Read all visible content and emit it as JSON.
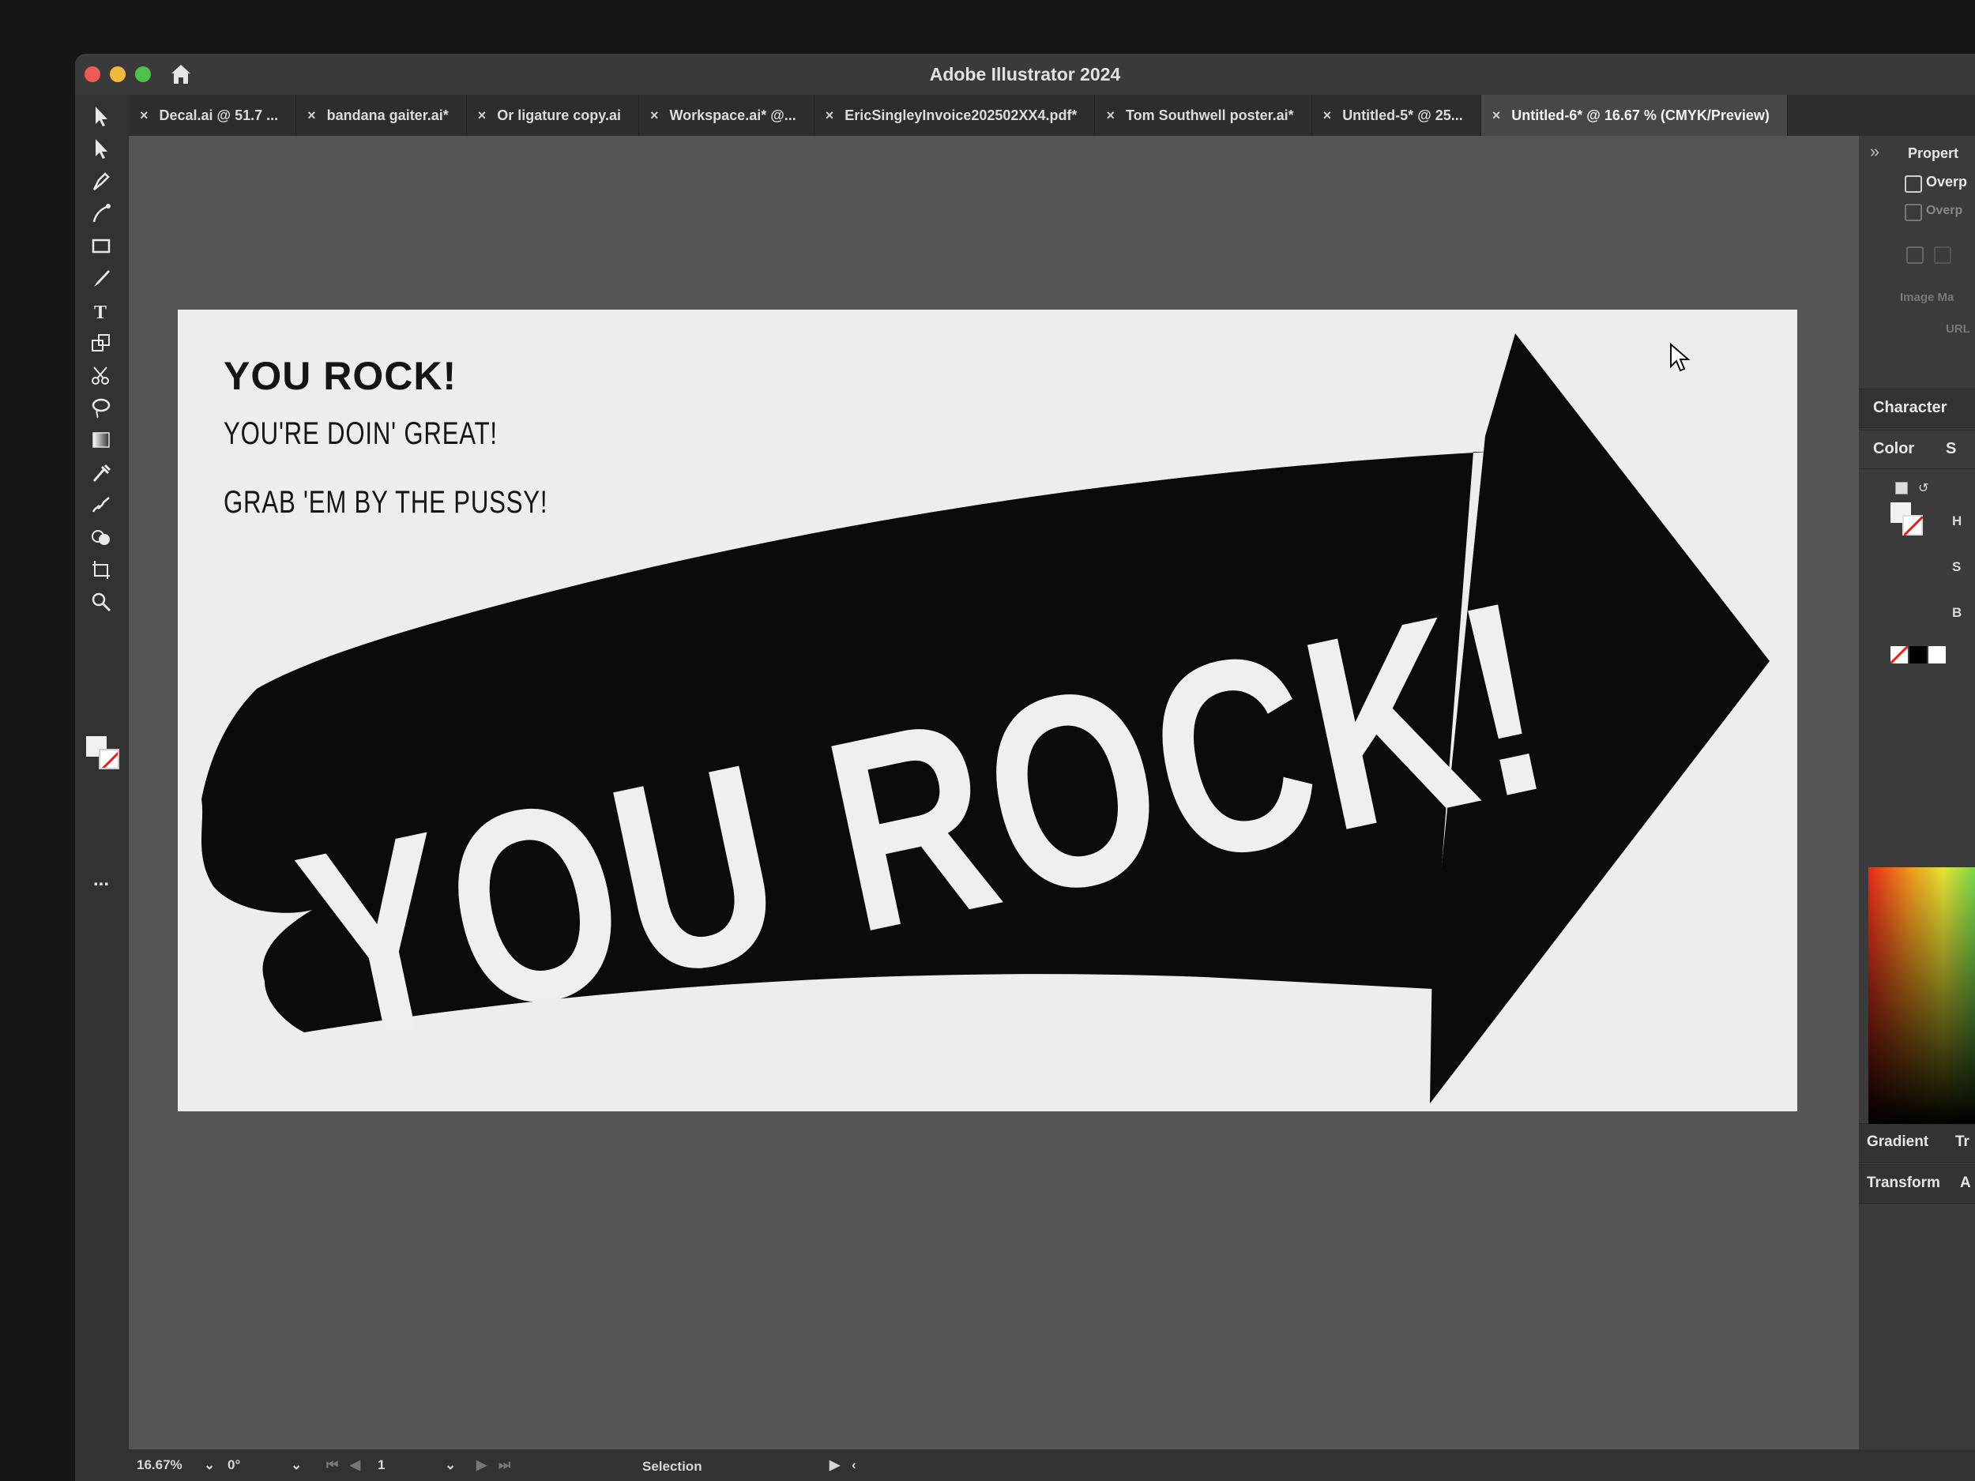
{
  "window": {
    "title": "Adobe Illustrator 2024"
  },
  "tabs": [
    {
      "label": "Decal.ai @ 51.7 ...",
      "active": false
    },
    {
      "label": "bandana gaiter.ai*",
      "active": false
    },
    {
      "label": "Or ligature copy.ai",
      "active": false
    },
    {
      "label": "Workspace.ai* @...",
      "active": false
    },
    {
      "label": "EricSingleyInvoice202502XX4.pdf*",
      "active": false
    },
    {
      "label": "Tom Southwell poster.ai*",
      "active": false
    },
    {
      "label": "Untitled-5* @ 25...",
      "active": false
    },
    {
      "label": "Untitled-6* @ 16.67 % (CMYK/Preview)",
      "active": true
    }
  ],
  "tab_close_glyph": "×",
  "panel_collapse_glyph": "»",
  "tools": [
    "selection-tool-icon",
    "direct-selection-tool-icon",
    "pen-tool-icon",
    "curvature-tool-icon",
    "rectangle-tool-icon",
    "paintbrush-tool-icon",
    "type-tool-icon",
    "scale-tool-icon",
    "scissors-tool-icon",
    "lasso-tool-icon",
    "gradient-tool-icon",
    "eyedropper-tool-icon",
    "puppet-warp-tool-icon",
    "shape-builder-tool-icon",
    "artboard-tool-icon",
    "zoom-tool-icon"
  ],
  "toolbar_more": "...",
  "artboard": {
    "small_title": "YOU ROCK!",
    "small_line_1": "YOU'RE DOIN' GREAT!",
    "small_line_2": "GRAB 'EM BY THE PUSSY!",
    "big_text": "YOU ROCK!"
  },
  "right_panel": {
    "properties_label": "Propert",
    "overprint_1": "Overp",
    "overprint_2": "Overp",
    "image_map_label": "Image Ma",
    "url_label": "URL",
    "character_label": "Character",
    "color_label": "Color",
    "color_tab_2": "S",
    "hsb": {
      "h": "H",
      "s": "S",
      "b": "B"
    },
    "gradient_label": "Gradient",
    "gradient_tab_2": "Tr",
    "transform_label": "Transform",
    "transform_tab_2": "A"
  },
  "statusbar": {
    "zoom": "16.67%",
    "rotation": "0°",
    "artboard_number": "1",
    "tool_name": "Selection"
  },
  "colors": {
    "artboard_bg": "#ededed",
    "art_black": "#0b0b0b",
    "art_white": "#efefef",
    "ui_dark": "#323232"
  }
}
